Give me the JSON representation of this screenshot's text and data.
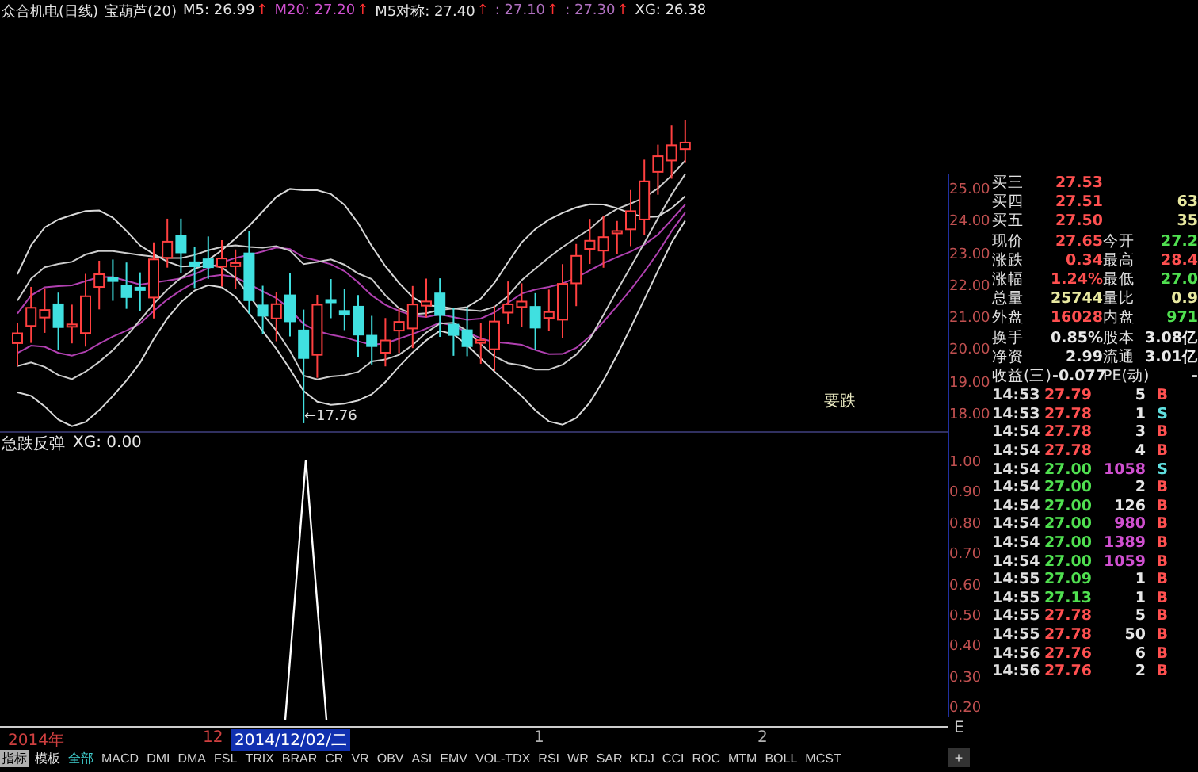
{
  "header": {
    "title": "众合机电(日线)",
    "indicator": "宝葫芦(20)",
    "values": [
      {
        "text": "M5: 26.99",
        "color": "#e6e6e6",
        "arrow": "↑"
      },
      {
        "text": "M20: 27.20",
        "color": "#d050d0",
        "arrow": "↑"
      },
      {
        "text": "M5对称: 27.40",
        "color": "#e6e6e6",
        "arrow": "↑"
      },
      {
        "text": ": 27.10",
        "color": "#b070c0",
        "arrow": "↑"
      },
      {
        "text": ": 27.30",
        "color": "#b070c0",
        "arrow": "↑"
      },
      {
        "text": "XG: 26.38",
        "color": "#e6e6e6"
      }
    ]
  },
  "price_chart": {
    "low_label": "←17.76",
    "signal_label": "要跌",
    "axis": [
      "25.00",
      "24.00",
      "23.00",
      "22.00",
      "21.00",
      "20.00",
      "19.00",
      "18.00"
    ]
  },
  "indicator_chart": {
    "name": "急跌反弹",
    "value": "XG: 0.00",
    "axis": [
      "1.00",
      "0.90",
      "0.80",
      "0.70",
      "0.60",
      "0.50",
      "0.40",
      "0.30",
      "0.20"
    ]
  },
  "quote": {
    "bids": [
      {
        "label": "买三",
        "price": "27.53"
      },
      {
        "label": "买四",
        "price": "27.51",
        "volume": "63"
      },
      {
        "label": "买五",
        "price": "27.50",
        "volume": "35"
      }
    ],
    "stats": [
      {
        "label": "现价",
        "value": "27.65",
        "up": true,
        "label2": "今开",
        "value2": "27.2",
        "up2": false
      },
      {
        "label": "涨跌",
        "value": "0.34",
        "up": true,
        "label2": "最高",
        "value2": "28.4",
        "up2": true
      },
      {
        "label": "涨幅",
        "value": "1.24%",
        "up": true,
        "label2": "最低",
        "value2": "27.0",
        "up2": false
      },
      {
        "label": "总量",
        "value": "25744",
        "highlighted": true,
        "label2": "量比",
        "value2": "0.9"
      },
      {
        "label": "外盘",
        "value": "16028",
        "up": true,
        "label2": "内盘",
        "value2": "971",
        "up2": false
      },
      {
        "label": "换手",
        "value": "0.85%",
        "label2": "股本",
        "value2": "3.08亿"
      },
      {
        "label": "净资",
        "value": "2.99",
        "label2": "流通",
        "value2": "3.01亿"
      },
      {
        "label": "收益(三)",
        "value": "-0.077",
        "label2": "PE(动)",
        "value2": "-"
      }
    ],
    "trades": [
      {
        "time": "14:53",
        "price": "27.79",
        "rising": true,
        "volume": "5",
        "large": false,
        "side": "B",
        "kind": "buy"
      },
      {
        "time": "14:53",
        "price": "27.78",
        "rising": true,
        "volume": "1",
        "large": false,
        "side": "S",
        "kind": "sell"
      },
      {
        "time": "14:54",
        "price": "27.78",
        "rising": true,
        "volume": "3",
        "large": false,
        "side": "B",
        "kind": "buy"
      },
      {
        "time": "14:54",
        "price": "27.78",
        "rising": true,
        "volume": "4",
        "large": false,
        "side": "B",
        "kind": "buy"
      },
      {
        "time": "14:54",
        "price": "27.00",
        "rising": false,
        "volume": "1058",
        "large": true,
        "side": "S",
        "kind": "sell"
      },
      {
        "time": "14:54",
        "price": "27.00",
        "rising": false,
        "volume": "2",
        "large": false,
        "side": "B",
        "kind": "buy"
      },
      {
        "time": "14:54",
        "price": "27.00",
        "rising": false,
        "volume": "126",
        "large": false,
        "side": "B",
        "kind": "buy"
      },
      {
        "time": "14:54",
        "price": "27.00",
        "rising": false,
        "volume": "980",
        "large": true,
        "side": "B",
        "kind": "buy"
      },
      {
        "time": "14:54",
        "price": "27.00",
        "rising": false,
        "volume": "1389",
        "large": true,
        "side": "B",
        "kind": "buy"
      },
      {
        "time": "14:54",
        "price": "27.00",
        "rising": false,
        "volume": "1059",
        "large": true,
        "side": "B",
        "kind": "buy"
      },
      {
        "time": "14:55",
        "price": "27.09",
        "rising": false,
        "volume": "1",
        "large": false,
        "side": "B",
        "kind": "buy"
      },
      {
        "time": "14:55",
        "price": "27.13",
        "rising": false,
        "volume": "1",
        "large": false,
        "side": "B",
        "kind": "buy"
      },
      {
        "time": "14:55",
        "price": "27.78",
        "rising": true,
        "volume": "5",
        "large": false,
        "side": "B",
        "kind": "buy"
      },
      {
        "time": "14:55",
        "price": "27.78",
        "rising": true,
        "volume": "50",
        "large": false,
        "side": "B",
        "kind": "buy"
      },
      {
        "time": "14:56",
        "price": "27.76",
        "rising": true,
        "volume": "6",
        "large": false,
        "side": "B",
        "kind": "buy"
      },
      {
        "time": "14:56",
        "price": "27.76",
        "rising": true,
        "volume": "2",
        "large": false,
        "side": "B",
        "kind": "buy"
      }
    ]
  },
  "date_axis": [
    {
      "text": "2014年",
      "kind": "year"
    },
    {
      "text": "12",
      "kind": "month"
    },
    {
      "text": "2014/12/02/二",
      "kind": "cursor"
    },
    {
      "text": "1",
      "kind": "plain"
    },
    {
      "text": "2",
      "kind": "plain"
    }
  ],
  "corner": {
    "label": "E",
    "button": "+"
  },
  "tabs": [
    {
      "label": "指标",
      "kind": "mode",
      "selected": true
    },
    {
      "label": "模板",
      "kind": "mode",
      "selected": false
    },
    {
      "label": "全部",
      "kind": "filter",
      "selected": false
    },
    {
      "label": "MACD",
      "kind": "indicator",
      "selected": false
    },
    {
      "label": "DMI",
      "kind": "indicator",
      "selected": false
    },
    {
      "label": "DMA",
      "kind": "indicator",
      "selected": false
    },
    {
      "label": "FSL",
      "kind": "indicator",
      "selected": false
    },
    {
      "label": "TRIX",
      "kind": "indicator",
      "selected": false
    },
    {
      "label": "BRAR",
      "kind": "indicator",
      "selected": false
    },
    {
      "label": "CR",
      "kind": "indicator",
      "selected": false
    },
    {
      "label": "VR",
      "kind": "indicator",
      "selected": false
    },
    {
      "label": "OBV",
      "kind": "indicator",
      "selected": false
    },
    {
      "label": "ASI",
      "kind": "indicator",
      "selected": false
    },
    {
      "label": "EMV",
      "kind": "indicator",
      "selected": false
    },
    {
      "label": "VOL-TDX",
      "kind": "indicator",
      "selected": false
    },
    {
      "label": "RSI",
      "kind": "indicator",
      "selected": false
    },
    {
      "label": "WR",
      "kind": "indicator",
      "selected": false
    },
    {
      "label": "SAR",
      "kind": "indicator",
      "selected": false
    },
    {
      "label": "KDJ",
      "kind": "indicator",
      "selected": false
    },
    {
      "label": "CCI",
      "kind": "indicator",
      "selected": false
    },
    {
      "label": "ROC",
      "kind": "indicator",
      "selected": false
    },
    {
      "label": "MTM",
      "kind": "indicator",
      "selected": false
    },
    {
      "label": "BOLL",
      "kind": "indicator",
      "selected": false
    },
    {
      "label": "MCST",
      "kind": "indicator",
      "selected": false
    }
  ]
}
